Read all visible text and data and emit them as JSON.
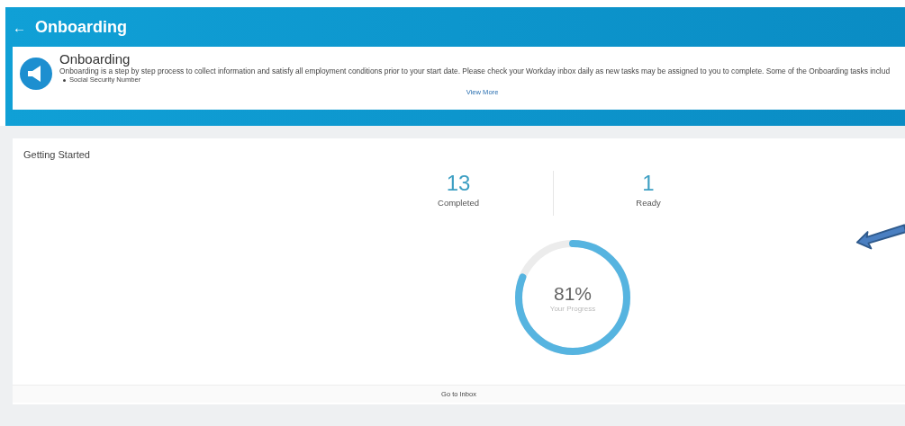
{
  "header": {
    "back": "←",
    "title": "Onboarding"
  },
  "banner": {
    "title": "Onboarding",
    "description": "Onboarding is a step by step process to collect information and satisfy all employment conditions prior to your start date. Please check your Workday inbox daily as new tasks may be assigned to you to complete. Some of the Onboarding tasks includ",
    "bullets": [
      "Social Security Number"
    ],
    "link": "View More"
  },
  "panel": {
    "title": "Getting Started",
    "stats": [
      {
        "value": "13",
        "label": "Completed"
      },
      {
        "value": "1",
        "label": "Ready"
      }
    ],
    "progress": {
      "level": 0.81,
      "reading": "81%",
      "caption": "Your Progress"
    },
    "footer": "Go to Inbox"
  }
}
